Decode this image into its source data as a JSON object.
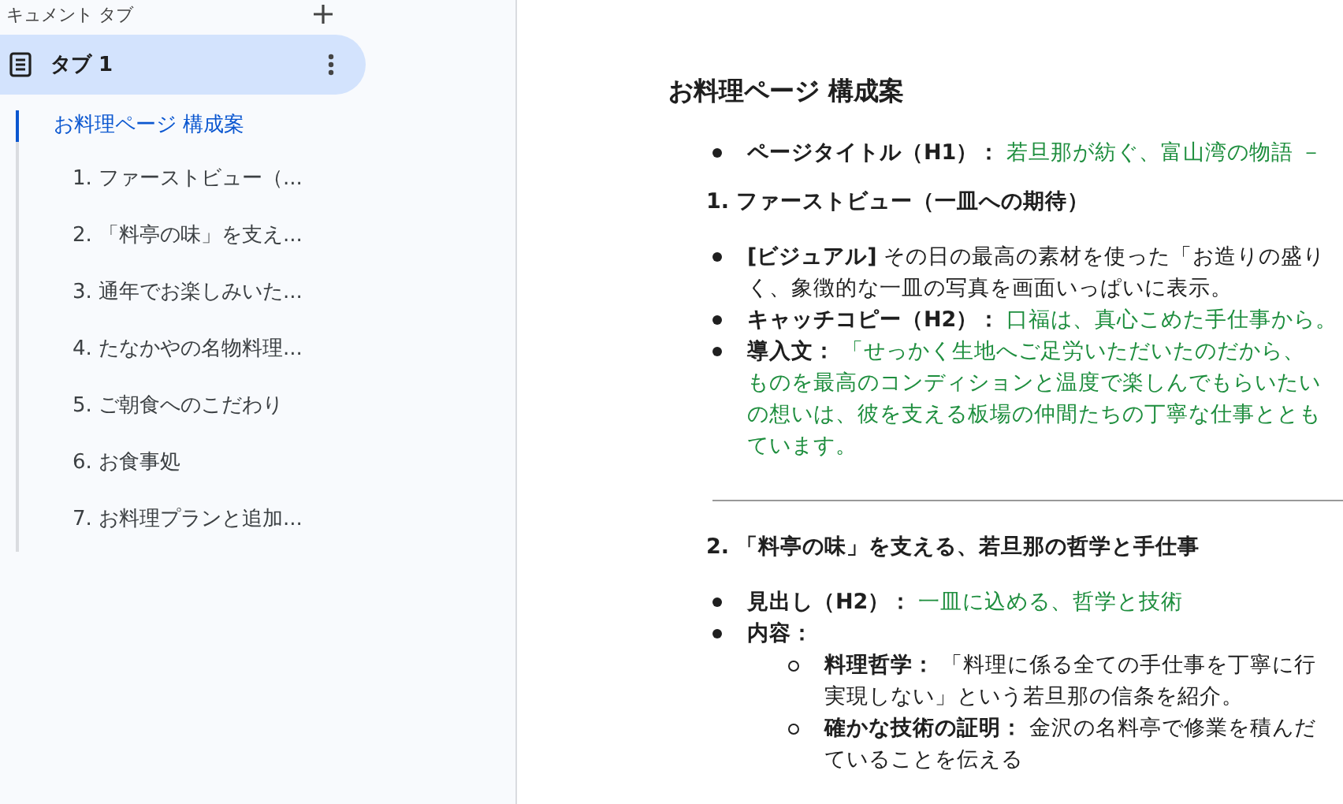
{
  "sidebar": {
    "header": "キュメント タブ",
    "tab": {
      "label": "タブ 1",
      "selected": true
    },
    "outline": [
      {
        "label": "お料理ページ 構成案",
        "selected": true,
        "children": [
          {
            "label": "1. ファーストビュー（...",
            "selected": false
          },
          {
            "label": "2. 「料亭の味」を支え...",
            "selected": false
          },
          {
            "label": "3. 通年でお楽しみいた...",
            "selected": false
          },
          {
            "label": "4. たなかやの名物料理...",
            "selected": false
          },
          {
            "label": "5. ご朝食へのこだわり",
            "selected": false
          },
          {
            "label": "6. お食事処",
            "selected": false
          },
          {
            "label": "7. お料理プランと追加...",
            "selected": false
          }
        ]
      }
    ]
  },
  "document": {
    "blocks": [
      {
        "kind": "title",
        "text": "お料理ページ 構成案"
      },
      {
        "kind": "bullet",
        "label": "ページタイトル（H1）：",
        "highlight": true,
        "lines": [
          "若旦那が紡ぐ、富山湾の物語 －"
        ]
      },
      {
        "kind": "heading",
        "text": "1. ファーストビュー（一皿への期待）"
      },
      {
        "kind": "bullet",
        "label": "[ビジュアル]",
        "lines": [
          "その日の最高の素材を使った「お造りの盛り",
          "く、象徴的な一皿の写真を画面いっぱいに表示。"
        ]
      },
      {
        "kind": "bullet",
        "label": "キャッチコピー（H2）：",
        "highlight": true,
        "lines": [
          "口福は、真心こめた手仕事から。"
        ]
      },
      {
        "kind": "bullet",
        "label": "導入文：",
        "highlight": true,
        "lines": [
          "「せっかく生地へご足労いただいたのだから、",
          "ものを最高のコンディションと温度で楽しんでもらいたい",
          "の想いは、彼を支える板場の仲間たちの丁寧な仕事ととも",
          "ています。"
        ]
      },
      {
        "kind": "rule"
      },
      {
        "kind": "heading",
        "text": "2. 「料亭の味」を支える、若旦那の哲学と手仕事"
      },
      {
        "kind": "bullet",
        "label": "見出し（H2）：",
        "highlight": true,
        "lines": [
          "一皿に込める、哲学と技術"
        ]
      },
      {
        "kind": "bullet",
        "label": "内容："
      },
      {
        "kind": "subbullet",
        "label": "料理哲学：",
        "lines": [
          "「料理に係る全ての手仕事を丁寧に行",
          "実現しない」という若旦那の信条を紹介。"
        ]
      },
      {
        "kind": "subbullet",
        "label": "確かな技術の証明：",
        "lines": [
          "金沢の名料亭で修業を積んだ",
          "ていることを伝える"
        ]
      }
    ]
  }
}
